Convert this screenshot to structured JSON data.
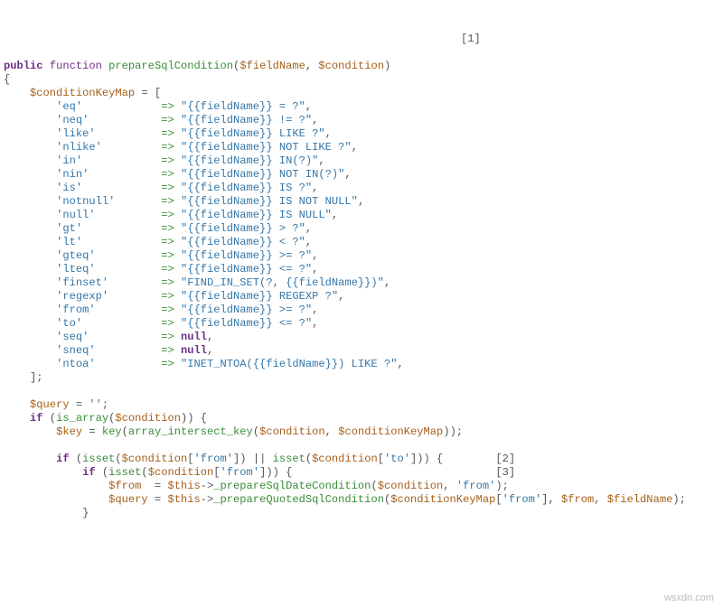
{
  "kw_public": "public",
  "kw_function": "function",
  "kw_if": "if",
  "kw_null": "null",
  "fn_name": "prepareSqlCondition",
  "var_fieldName": "$fieldName",
  "var_condition": "$condition",
  "var_conditionKeyMap": "$conditionKeyMap",
  "var_query": "$query",
  "var_key": "$key",
  "var_from": "$from",
  "var_this": "$this",
  "fn_is_array": "is_array",
  "fn_key": "key",
  "fn_array_intersect_key": "array_intersect_key",
  "fn_isset": "isset",
  "meth_prepareSqlDateCondition": "_prepareSqlDateCondition",
  "meth_prepareQuotedSqlCondition": "_prepareQuotedSqlCondition",
  "annot1": "[1]",
  "annot2": "[2]",
  "annot3": "[3]",
  "map": [
    {
      "k": "'eq'",
      "pad": "          ",
      "v": "\"{{fieldName}} = ?\""
    },
    {
      "k": "'neq'",
      "pad": "         ",
      "v": "\"{{fieldName}} != ?\""
    },
    {
      "k": "'like'",
      "pad": "        ",
      "v": "\"{{fieldName}} LIKE ?\""
    },
    {
      "k": "'nlike'",
      "pad": "       ",
      "v": "\"{{fieldName}} NOT LIKE ?\""
    },
    {
      "k": "'in'",
      "pad": "          ",
      "v": "\"{{fieldName}} IN(?)\""
    },
    {
      "k": "'nin'",
      "pad": "         ",
      "v": "\"{{fieldName}} NOT IN(?)\""
    },
    {
      "k": "'is'",
      "pad": "          ",
      "v": "\"{{fieldName}} IS ?\""
    },
    {
      "k": "'notnull'",
      "pad": "     ",
      "v": "\"{{fieldName}} IS NOT NULL\""
    },
    {
      "k": "'null'",
      "pad": "        ",
      "v": "\"{{fieldName}} IS NULL\""
    },
    {
      "k": "'gt'",
      "pad": "          ",
      "v": "\"{{fieldName}} > ?\""
    },
    {
      "k": "'lt'",
      "pad": "          ",
      "v": "\"{{fieldName}} < ?\""
    },
    {
      "k": "'gteq'",
      "pad": "        ",
      "v": "\"{{fieldName}} >= ?\""
    },
    {
      "k": "'lteq'",
      "pad": "        ",
      "v": "\"{{fieldName}} <= ?\""
    },
    {
      "k": "'finset'",
      "pad": "      ",
      "v": "\"FIND_IN_SET(?, {{fieldName}})\""
    },
    {
      "k": "'regexp'",
      "pad": "      ",
      "v": "\"{{fieldName}} REGEXP ?\""
    },
    {
      "k": "'from'",
      "pad": "        ",
      "v": "\"{{fieldName}} >= ?\""
    },
    {
      "k": "'to'",
      "pad": "          ",
      "v": "\"{{fieldName}} <= ?\""
    },
    {
      "k": "'seq'",
      "pad": "         ",
      "v": null
    },
    {
      "k": "'sneq'",
      "pad": "        ",
      "v": null
    },
    {
      "k": "'ntoa'",
      "pad": "        ",
      "v": "\"INET_NTOA({{fieldName}}) LIKE ?\""
    }
  ],
  "str_empty": "''",
  "str_from": "'from'",
  "str_to": "'to'",
  "watermark": "wsxdn.com"
}
